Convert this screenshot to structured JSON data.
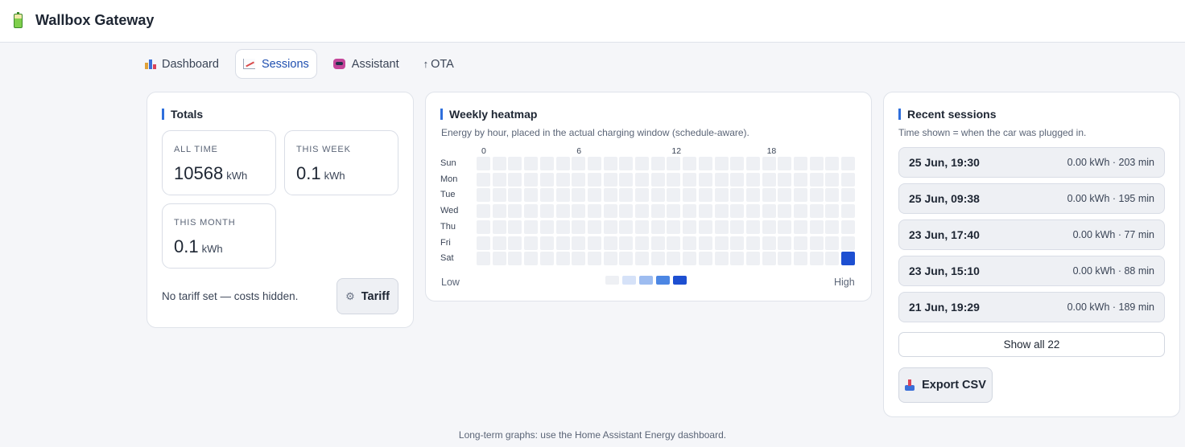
{
  "app": {
    "title": "Wallbox Gateway",
    "icon": "battery-icon"
  },
  "tabs": [
    {
      "label": "Dashboard",
      "icon": "bar-chart-icon",
      "active": false
    },
    {
      "label": "Sessions",
      "icon": "line-chart-icon",
      "active": true
    },
    {
      "label": "Assistant",
      "icon": "robot-icon",
      "active": false
    },
    {
      "label": "OTA",
      "icon": "up-arrow-icon",
      "active": false
    }
  ],
  "totals": {
    "title": "Totals",
    "all_time": {
      "label": "ALL TIME",
      "value": "10568",
      "unit": "kWh"
    },
    "this_week": {
      "label": "THIS WEEK",
      "value": "0.1",
      "unit": "kWh"
    },
    "this_month": {
      "label": "THIS MONTH",
      "value": "0.1",
      "unit": "kWh"
    },
    "tariff_note": "No tariff set — costs hidden.",
    "tariff_button": "Tariff"
  },
  "heatmap": {
    "title": "Weekly heatmap",
    "subtitle": "Energy by hour, placed in the actual charging window (schedule-aware).",
    "hour_ticks": [
      "0",
      "6",
      "12",
      "18"
    ],
    "days": [
      "Sun",
      "Mon",
      "Tue",
      "Wed",
      "Thu",
      "Fri",
      "Sat"
    ],
    "hours_per_day": 24,
    "levels": [
      [
        0,
        0,
        0,
        0,
        0,
        0,
        0,
        0,
        0,
        0,
        0,
        0,
        0,
        0,
        0,
        0,
        0,
        0,
        0,
        0,
        0,
        0,
        0,
        0
      ],
      [
        0,
        0,
        0,
        0,
        0,
        0,
        0,
        0,
        0,
        0,
        0,
        0,
        0,
        0,
        0,
        0,
        0,
        0,
        0,
        0,
        0,
        0,
        0,
        0
      ],
      [
        0,
        0,
        0,
        0,
        0,
        0,
        0,
        0,
        0,
        0,
        0,
        0,
        0,
        0,
        0,
        0,
        0,
        0,
        0,
        0,
        0,
        0,
        0,
        0
      ],
      [
        0,
        0,
        0,
        0,
        0,
        0,
        0,
        0,
        0,
        0,
        0,
        0,
        0,
        0,
        0,
        0,
        0,
        0,
        0,
        0,
        0,
        0,
        0,
        0
      ],
      [
        0,
        0,
        0,
        0,
        0,
        0,
        0,
        0,
        0,
        0,
        0,
        0,
        0,
        0,
        0,
        0,
        0,
        0,
        0,
        0,
        0,
        0,
        0,
        0
      ],
      [
        0,
        0,
        0,
        0,
        0,
        0,
        0,
        0,
        0,
        0,
        0,
        0,
        0,
        0,
        0,
        0,
        0,
        0,
        0,
        0,
        0,
        0,
        0,
        0
      ],
      [
        0,
        0,
        0,
        0,
        0,
        0,
        0,
        0,
        0,
        0,
        0,
        0,
        0,
        0,
        0,
        0,
        0,
        0,
        0,
        0,
        0,
        0,
        0,
        4
      ]
    ],
    "scale_colors": [
      "#eef0f4",
      "#d6e2f8",
      "#9dbcf0",
      "#4c86e3",
      "#1d4fd1"
    ],
    "legend_low": "Low",
    "legend_high": "High"
  },
  "recent": {
    "title": "Recent sessions",
    "subtitle": "Time shown = when the car was plugged in.",
    "sessions": [
      {
        "date": "25 Jun, 19:30",
        "info": "0.00 kWh · 203 min"
      },
      {
        "date": "25 Jun, 09:38",
        "info": "0.00 kWh · 195 min"
      },
      {
        "date": "23 Jun, 17:40",
        "info": "0.00 kWh · 77 min"
      },
      {
        "date": "23 Jun, 15:10",
        "info": "0.00 kWh · 88 min"
      },
      {
        "date": "21 Jun, 19:29",
        "info": "0.00 kWh · 189 min"
      }
    ],
    "show_all": "Show all 22",
    "export": "Export CSV"
  },
  "footer": "Long-term graphs: use the Home Assistant Energy dashboard.",
  "colors": {
    "accent": "#2f6fdc",
    "active_tab_text": "#1f4fb0"
  }
}
